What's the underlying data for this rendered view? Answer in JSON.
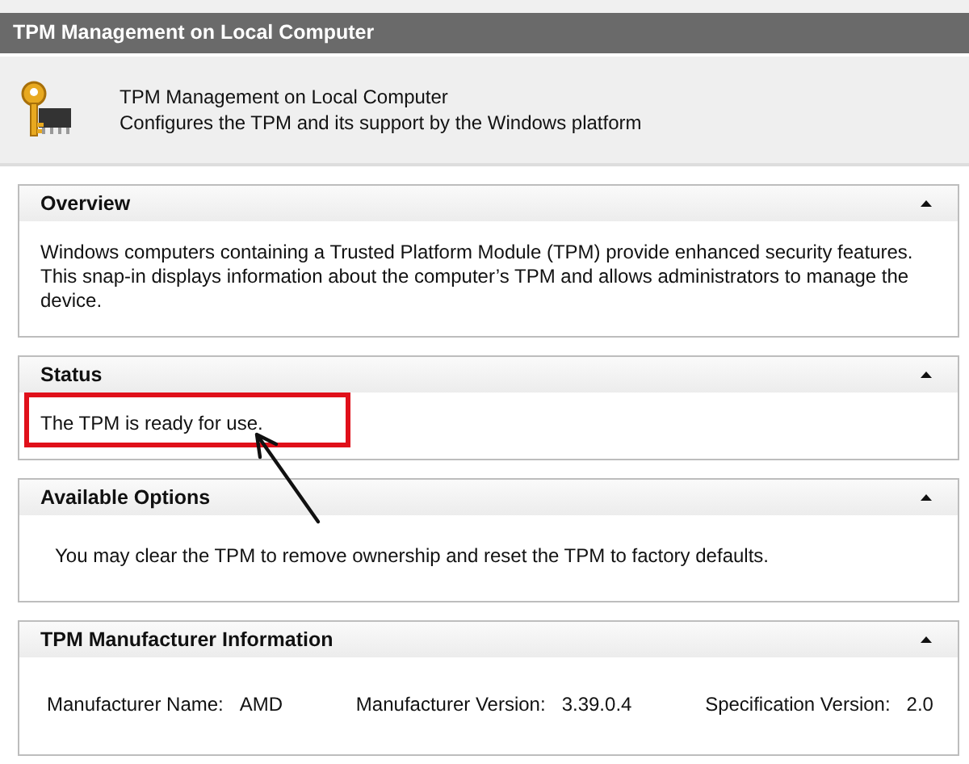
{
  "window": {
    "title": "TPM Management on Local Computer"
  },
  "header": {
    "title": "TPM Management on Local Computer",
    "description": "Configures the TPM and its support by the Windows platform"
  },
  "sections": [
    {
      "kind": "text",
      "title": "Overview",
      "expanded": true,
      "highlighted": false,
      "text": "Windows computers containing a Trusted Platform Module (TPM) provide enhanced security features. This snap-in displays information about the computer’s TPM and allows administrators to manage the device."
    },
    {
      "kind": "text",
      "title": "Status",
      "expanded": true,
      "highlighted": true,
      "text": "The TPM is ready for use."
    },
    {
      "kind": "text",
      "title": "Available Options",
      "expanded": true,
      "highlighted": false,
      "text": "You may clear the TPM to remove ownership and reset the TPM to factory defaults."
    },
    {
      "kind": "fields",
      "title": "TPM Manufacturer Information",
      "expanded": true,
      "fields": [
        {
          "label": "Manufacturer Name:",
          "value": "AMD"
        },
        {
          "label": "Manufacturer Version:",
          "value": "3.39.0.4"
        },
        {
          "label": "Specification Version:",
          "value": "2.0"
        }
      ]
    }
  ]
}
